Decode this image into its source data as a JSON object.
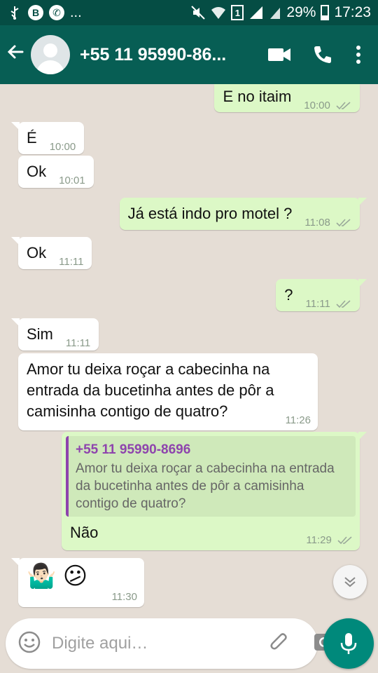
{
  "status_bar": {
    "notification_letter": "B",
    "notification_more": "...",
    "sim_slot": "1",
    "battery": "29%",
    "time": "17:23"
  },
  "header": {
    "contact": "+55 11 95990-86..."
  },
  "messages": [
    {
      "dir": "out",
      "text": "E no itaim",
      "time": "10:00"
    },
    {
      "dir": "in",
      "text": "É",
      "time": "10:00"
    },
    {
      "dir": "in",
      "text": "Ok",
      "time": "10:01"
    },
    {
      "dir": "out",
      "text": "Já está indo pro motel ?",
      "time": "11:08"
    },
    {
      "dir": "in",
      "text": "Ok",
      "time": "11:11"
    },
    {
      "dir": "out",
      "text": "?",
      "time": "11:11"
    },
    {
      "dir": "in",
      "text": "Sim",
      "time": "11:11"
    },
    {
      "dir": "in",
      "text": "Amor tu deixa roçar a cabecinha na entrada da bucetinha antes de pôr a camisinha contigo de quatro?",
      "time": "11:26"
    },
    {
      "dir": "out",
      "quote_name": "+55 11 95990-8696",
      "quote_text": "Amor tu deixa roçar a cabecinha na entrada da bucetinha antes de pôr a camisinha contigo de quatro?",
      "text": "Não",
      "time": "11:29"
    },
    {
      "dir": "in",
      "emoji": "🤷🏻‍♂️ 😕",
      "time": "11:30"
    }
  ],
  "input": {
    "placeholder": "Digite aqui…"
  },
  "colors": {
    "header": "#075e54",
    "status_bar": "#054d44",
    "outgoing_bubble": "#dcf8c6",
    "incoming_bubble": "#ffffff",
    "chat_background": "#e5ddd5",
    "read_ticks": "#8a9a8a",
    "quote_accent": "#8e44ad",
    "mic_button": "#00897b"
  },
  "icons": [
    "back-arrow-icon",
    "video-call-icon",
    "phone-call-icon",
    "more-vert-icon",
    "emoji-icon",
    "attach-icon",
    "camera-icon",
    "mic-icon",
    "scroll-down-icon",
    "double-check-icon"
  ]
}
